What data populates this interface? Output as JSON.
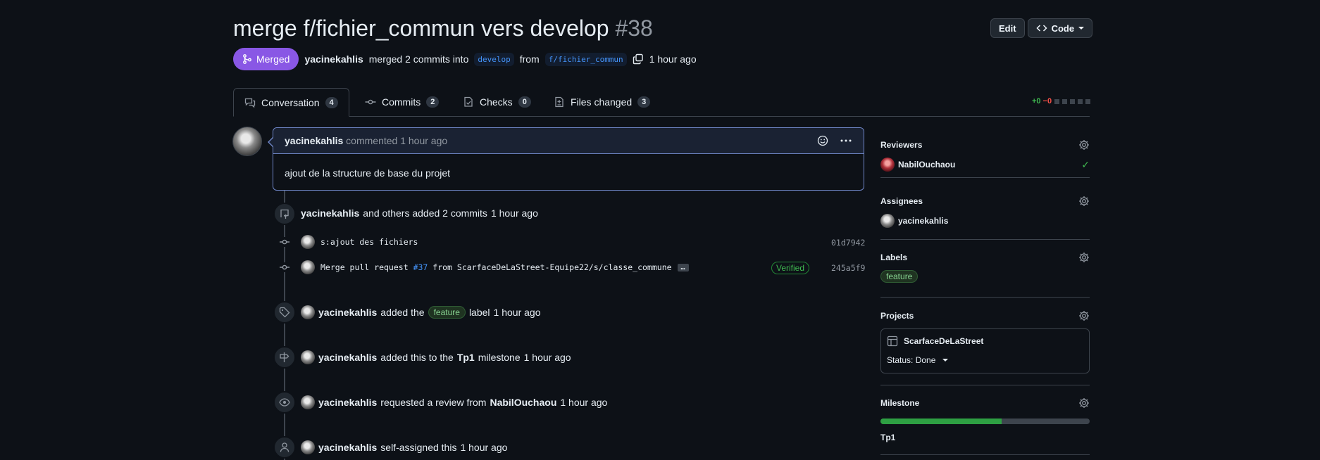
{
  "header": {
    "title": "merge f/fichier_commun vers develop",
    "number": "#38",
    "edit_label": "Edit",
    "code_label": "Code"
  },
  "meta": {
    "state": "Merged",
    "author": "yacinekahlis",
    "action": "merged 2 commits into",
    "base_branch": "develop",
    "from_text": "from",
    "head_branch": "f/fichier_commun",
    "time": "1 hour ago"
  },
  "tabs": [
    {
      "label": "Conversation",
      "count": "4"
    },
    {
      "label": "Commits",
      "count": "2"
    },
    {
      "label": "Checks",
      "count": "0"
    },
    {
      "label": "Files changed",
      "count": "3"
    }
  ],
  "diffstat": {
    "additions": "+0",
    "deletions": "−0"
  },
  "comment": {
    "author": "yacinekahlis",
    "verb": "commented",
    "time": "1 hour ago",
    "body": "ajout de la structure de base du projet"
  },
  "timeline": {
    "commits_event": {
      "author": "yacinekahlis",
      "text": "and others added 2 commits",
      "time": "1 hour ago"
    },
    "commits": [
      {
        "message": "s:ajout des fichiers",
        "sha": "01d7942"
      },
      {
        "message_pre": "Merge pull request",
        "link": "#37",
        "message_post": "from ScarfaceDeLaStreet-Equipe22/s/classe_commune",
        "ellipsis": "…",
        "verified": "Verified",
        "sha": "245a5f9"
      }
    ],
    "label_event": {
      "author": "yacinekahlis",
      "pre": "added the",
      "label": "feature",
      "post": "label",
      "time": "1 hour ago"
    },
    "milestone_event": {
      "author": "yacinekahlis",
      "pre": "added this to the",
      "milestone": "Tp1",
      "post": "milestone",
      "time": "1 hour ago"
    },
    "review_event": {
      "author": "yacinekahlis",
      "pre": "requested a review from",
      "reviewer": "NabilOuchaou",
      "time": "1 hour ago"
    },
    "assign_event": {
      "author": "yacinekahlis",
      "text": "self-assigned this",
      "time": "1 hour ago"
    }
  },
  "sidebar": {
    "reviewers": {
      "title": "Reviewers",
      "name": "NabilOuchaou"
    },
    "assignees": {
      "title": "Assignees",
      "name": "yacinekahlis"
    },
    "labels": {
      "title": "Labels",
      "label": "feature"
    },
    "projects": {
      "title": "Projects",
      "project": "ScarfaceDeLaStreet",
      "status": "Status: Done"
    },
    "milestone": {
      "title": "Milestone",
      "name": "Tp1",
      "progress": 0.58
    }
  },
  "colors": {
    "merged": "#8957e5",
    "accent": "#4493f8",
    "success": "#3fb950",
    "danger": "#f85149"
  }
}
